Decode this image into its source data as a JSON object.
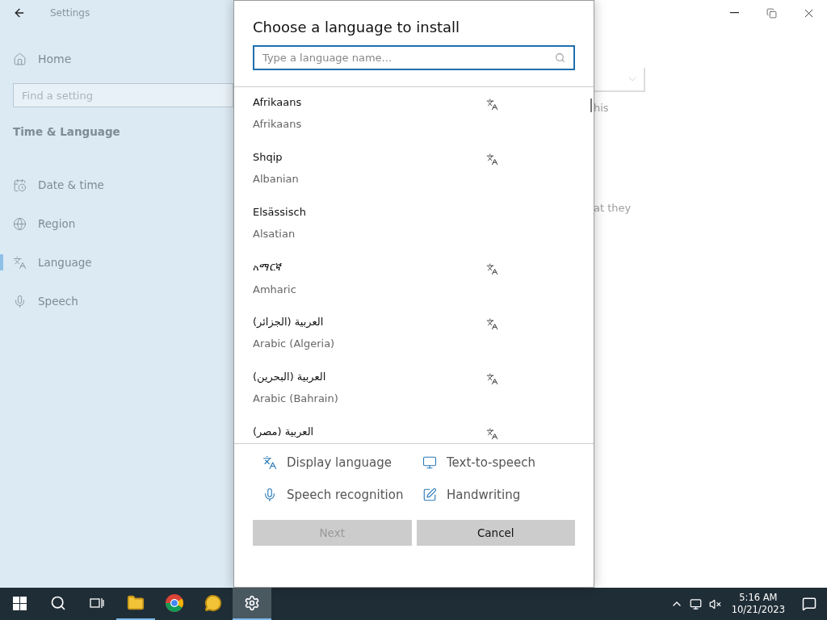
{
  "settings": {
    "title": "Settings",
    "home": "Home",
    "search": {
      "placeholder": "Find a setting"
    },
    "section": "Time & Language",
    "nav": [
      {
        "label": "Date & time",
        "selected": false
      },
      {
        "label": "Region",
        "selected": false
      },
      {
        "label": "Language",
        "selected": true
      },
      {
        "label": "Speech",
        "selected": false
      }
    ],
    "content_fragments": [
      "his",
      "at they"
    ]
  },
  "dialog": {
    "title": "Choose a language to install",
    "search": {
      "placeholder": "Type a language name..."
    },
    "languages": [
      {
        "name": "Afrikaans",
        "english": "Afrikaans",
        "display_language": true
      },
      {
        "name": "Shqip",
        "english": "Albanian",
        "display_language": true
      },
      {
        "name": "Elsässisch",
        "english": "Alsatian",
        "display_language": false
      },
      {
        "name": "አማርኛ",
        "english": "Amharic",
        "display_language": true
      },
      {
        "name": "العربية (الجزائر)",
        "english": "Arabic (Algeria)",
        "display_language": true
      },
      {
        "name": "العربية (البحرين)",
        "english": "Arabic (Bahrain)",
        "display_language": true
      },
      {
        "name": "العربية (مصر)",
        "display_language": true
      }
    ],
    "features": [
      {
        "kind": "display",
        "label": "Display language"
      },
      {
        "kind": "tts",
        "label": "Text-to-speech"
      },
      {
        "kind": "speech",
        "label": "Speech recognition"
      },
      {
        "kind": "handwriting",
        "label": "Handwriting"
      }
    ],
    "buttons": [
      {
        "label": "Next",
        "disabled": true
      },
      {
        "label": "Cancel",
        "disabled": false
      }
    ]
  },
  "taskbar": {
    "apps": [
      {
        "kind": "explorer",
        "running": true,
        "selected": false
      },
      {
        "kind": "browser",
        "running": false,
        "selected": false
      },
      {
        "kind": "chat",
        "running": false,
        "selected": false
      },
      {
        "kind": "settings",
        "running": true,
        "selected": true
      }
    ],
    "time": "5:16 AM",
    "date": "10/21/2023"
  }
}
